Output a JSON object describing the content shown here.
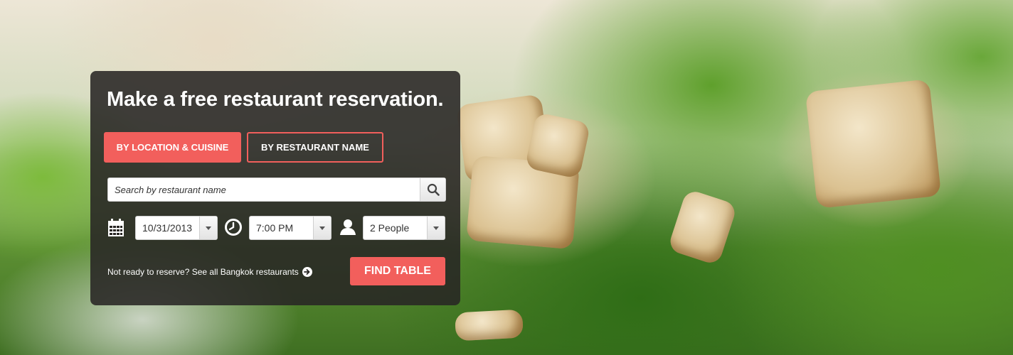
{
  "panel": {
    "title": "Make a free restaurant reservation.",
    "tabs": {
      "location": "BY LOCATION & CUISINE",
      "name": "BY RESTAURANT NAME"
    },
    "search": {
      "placeholder": "Search by restaurant name"
    },
    "date": {
      "value": "10/31/2013"
    },
    "time": {
      "value": "7:00 PM"
    },
    "party": {
      "value": "2 People"
    },
    "footer_link": "Not ready to reserve? See all Bangkok restaurants",
    "find_button": "FIND TABLE"
  },
  "colors": {
    "accent": "#f25f5c",
    "panel_bg": "#282624"
  },
  "icons": [
    "calendar-icon",
    "clock-icon",
    "person-icon",
    "search-icon",
    "arrow-right-circle-icon",
    "caret-down-icon"
  ]
}
